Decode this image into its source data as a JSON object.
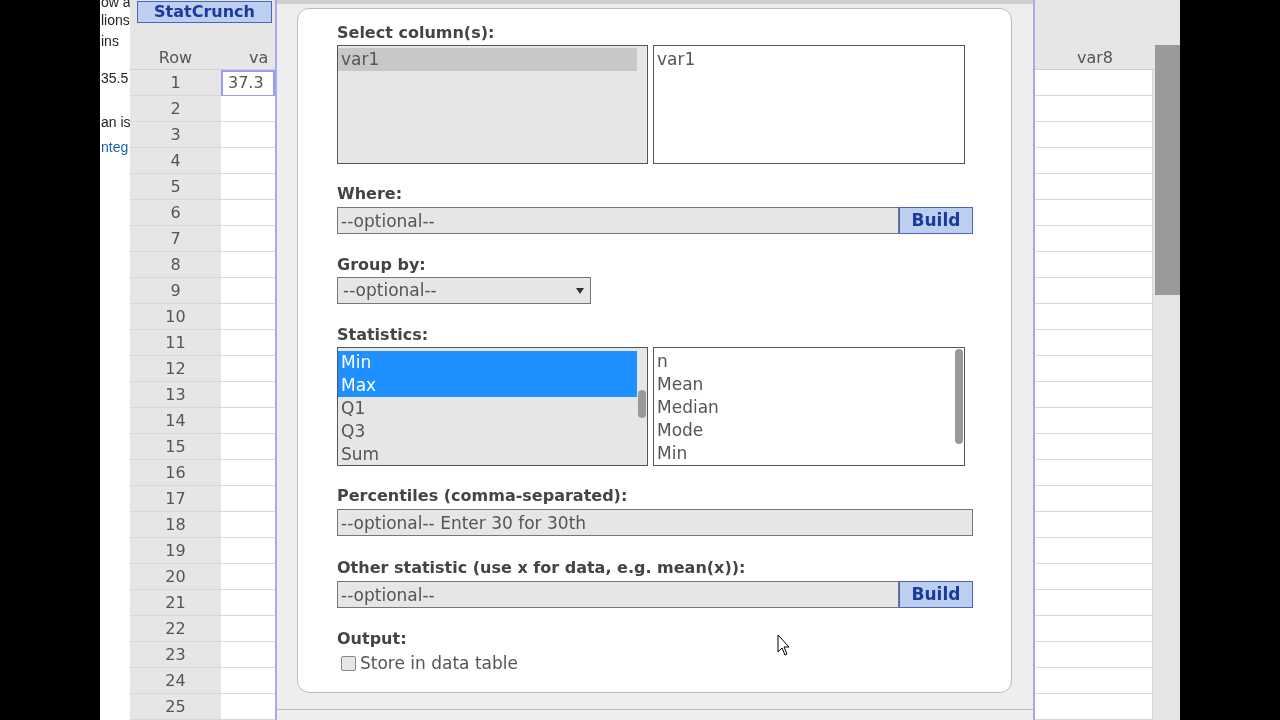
{
  "page_text": [
    {
      "text": "ow a",
      "kind": "text"
    },
    {
      "text": "lions",
      "kind": "text"
    },
    {
      "text": "ins",
      "kind": "text"
    },
    {
      "text": "35.5",
      "kind": "text"
    },
    {
      "text": "an is",
      "kind": "text"
    },
    {
      "text": "nteg",
      "kind": "link"
    }
  ],
  "app_button": "StatCrunch",
  "sheet": {
    "row_header": "Row",
    "left_column": "va",
    "right_column": "var8",
    "rows": [
      {
        "row": "1",
        "value": "37.3",
        "selected": true
      },
      {
        "row": "2",
        "selected": false
      },
      {
        "row": "3",
        "selected": false
      },
      {
        "row": "4",
        "selected": false
      },
      {
        "row": "5",
        "selected": false
      },
      {
        "row": "6",
        "selected": false
      },
      {
        "row": "7",
        "selected": false
      },
      {
        "row": "8",
        "selected": false
      },
      {
        "row": "9",
        "selected": false
      },
      {
        "row": "10",
        "selected": false
      },
      {
        "row": "11",
        "selected": false
      },
      {
        "row": "12",
        "selected": false
      },
      {
        "row": "13",
        "selected": false
      },
      {
        "row": "14",
        "selected": false
      },
      {
        "row": "15",
        "selected": false
      },
      {
        "row": "16",
        "selected": false
      },
      {
        "row": "17",
        "selected": false
      },
      {
        "row": "18",
        "selected": false
      },
      {
        "row": "19",
        "selected": false
      },
      {
        "row": "20",
        "selected": false
      },
      {
        "row": "21",
        "selected": false
      },
      {
        "row": "22",
        "selected": false
      },
      {
        "row": "23",
        "selected": false
      },
      {
        "row": "24",
        "selected": false
      },
      {
        "row": "25",
        "selected": false
      }
    ]
  },
  "dialog": {
    "select_columns": {
      "label": "Select column(s):",
      "available": [
        {
          "text": "var1",
          "selected": true
        }
      ],
      "chosen": [
        "var1"
      ]
    },
    "where": {
      "label": "Where:",
      "placeholder": "--optional--",
      "button": "Build"
    },
    "group_by": {
      "label": "Group by:",
      "value": "--optional--"
    },
    "statistics": {
      "label": "Statistics:",
      "available": [
        {
          "text": "Min",
          "selected": true
        },
        {
          "text": "Max",
          "selected": true
        },
        {
          "text": "Q1",
          "selected": false
        },
        {
          "text": "Q3",
          "selected": false
        },
        {
          "text": "Sum",
          "selected": false
        }
      ],
      "chosen": [
        "n",
        "Mean",
        "Median",
        "Mode",
        "Min"
      ]
    },
    "percentiles": {
      "label": "Percentiles (comma-separated):",
      "placeholder": "--optional-- Enter 30 for 30th"
    },
    "other": {
      "label": "Other statistic (use x for data, e.g. mean(x)):",
      "placeholder": "--optional--",
      "button": "Build"
    },
    "output": {
      "label": "Output:",
      "checkbox": {
        "label": "Store in data table",
        "checked": false
      }
    }
  }
}
